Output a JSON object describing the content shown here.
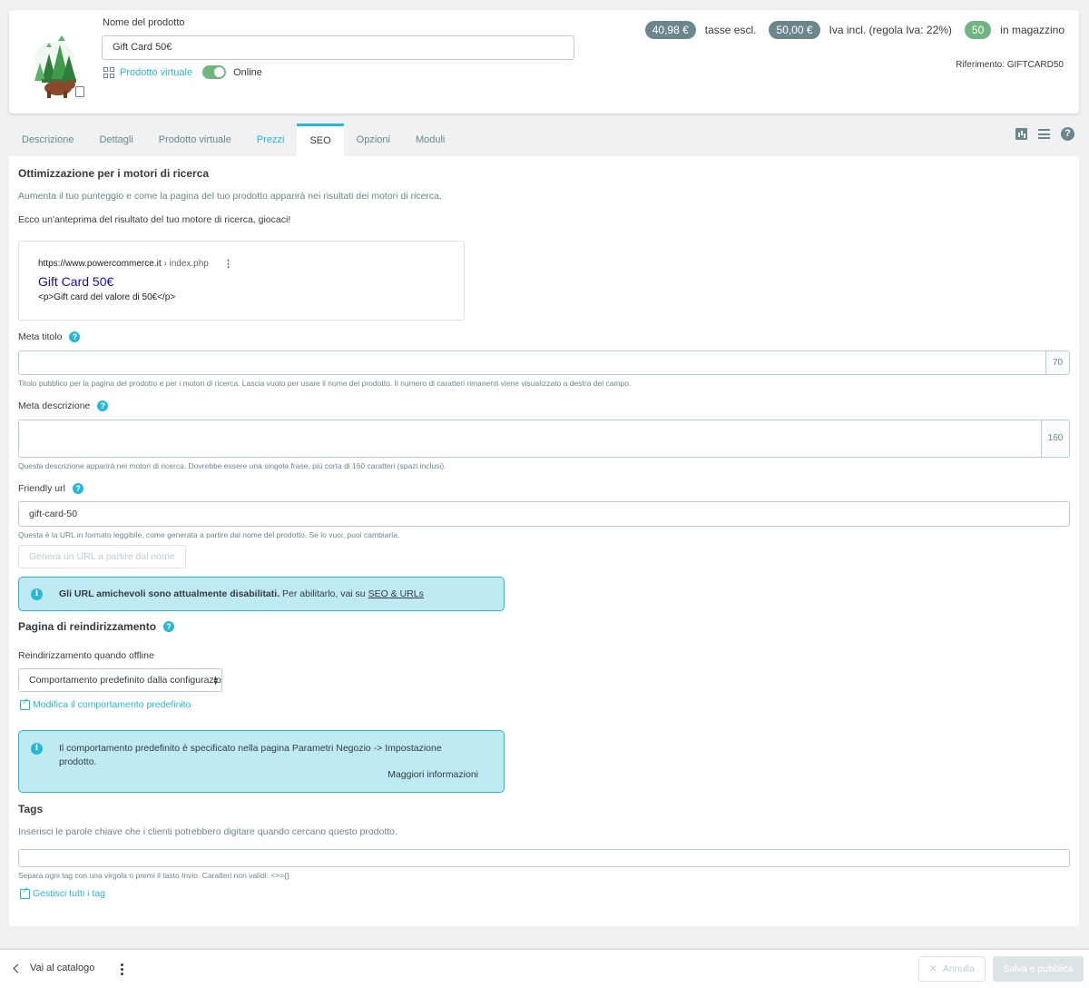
{
  "header": {
    "product_name_label": "Nome del prodotto",
    "product_name_value": "Gift Card 50€",
    "virtual_product_label": "Prodotto virtuale",
    "online_label": "Online",
    "online_enabled": true,
    "price_excl": "40,98 €",
    "price_excl_label": "tasse escl.",
    "price_incl": "50,00 €",
    "price_incl_label": "Iva incl. (regola Iva: 22%)",
    "stock": "50",
    "stock_label": "in magazzino",
    "reference": "Riferimento: GIFTCARD50"
  },
  "tabs": [
    {
      "label": "Descrizione"
    },
    {
      "label": "Dettagli"
    },
    {
      "label": "Prodotto virtuale"
    },
    {
      "label": "Prezzi"
    },
    {
      "label": "SEO"
    },
    {
      "label": "Opzioni"
    },
    {
      "label": "Moduli"
    }
  ],
  "active_tab": "SEO",
  "seo": {
    "title": "Ottimizzazione per i motori di ricerca",
    "subtitle": "Aumenta il tuo punteggio e come la pagina del tuo prodotto apparirà nei risultati dei motori di ricerca.",
    "preview_intro": "Ecco un'anteprima del risultato del tuo motore di ricerca, giocaci!",
    "preview": {
      "url": "https://www.powercommerce.it",
      "crumb": " › index.php",
      "title": "Gift Card 50€",
      "description": "<p>Gift card del valore di 50€</p>"
    },
    "meta_title": {
      "label": "Meta titolo",
      "value": "",
      "counter": "70",
      "help": "Titolo pubblico per la pagina del prodotto e per i motori di ricerca. Lascia vuoto per usare il nome del prodotto. Il numero di caratteri rimanenti viene visualizzato a destra del campo."
    },
    "meta_description": {
      "label": "Meta descrizione",
      "value": "",
      "counter": "160",
      "help": "Questa descrizione apparirà nei motori di ricerca. Dovrebbe essere una singola frase, più corta di 160 caratteri (spazi inclusi)."
    },
    "friendly_url": {
      "label": "Friendly url",
      "value": "gift-card-50",
      "help": "Questa è la URL in formato leggibile, come generata a partire dal nome del prodotto. Se lo vuoi, puoi cambiarla.",
      "generate_button": "Genera un URL a partire dal nome"
    },
    "url_alert": {
      "bold": "Gli URL amichevoli sono attualmente disabilitati.",
      "text": " Per abilitarlo, vai su ",
      "link": "SEO & URLs"
    }
  },
  "redirect": {
    "title": "Pagina di reindirizzamento",
    "offline_label": "Reindirizzamento quando offline",
    "select_value": "Comportamento predefinito dalla configurazione",
    "modify_link": "Modifica il comportamento predefinito",
    "alert_text": "Il comportamento predefinito è specificato nella pagina Parametri Negozio -> Impostazione prodotto.",
    "alert_more": "Maggiori informazioni"
  },
  "tags": {
    "title": "Tags",
    "subtitle": "Inserisci le parole chiave che i clienti potrebbero digitare quando cercano questo prodotto.",
    "value": "",
    "help": "Separa ogni tag con una virgola o premi il tasto Invio. Caratteri non validi: <>={}",
    "manage_link": "Gestisci tutti i tag"
  },
  "footer": {
    "back_label": "Vai al catalogo",
    "cancel_label": "Annulla",
    "save_label": "Salva e pubblica"
  },
  "colors": {
    "accent": "#25b9d7",
    "badge_dark": "#6c868e",
    "badge_green": "#70b580",
    "alert_bg": "#beeaf3"
  }
}
